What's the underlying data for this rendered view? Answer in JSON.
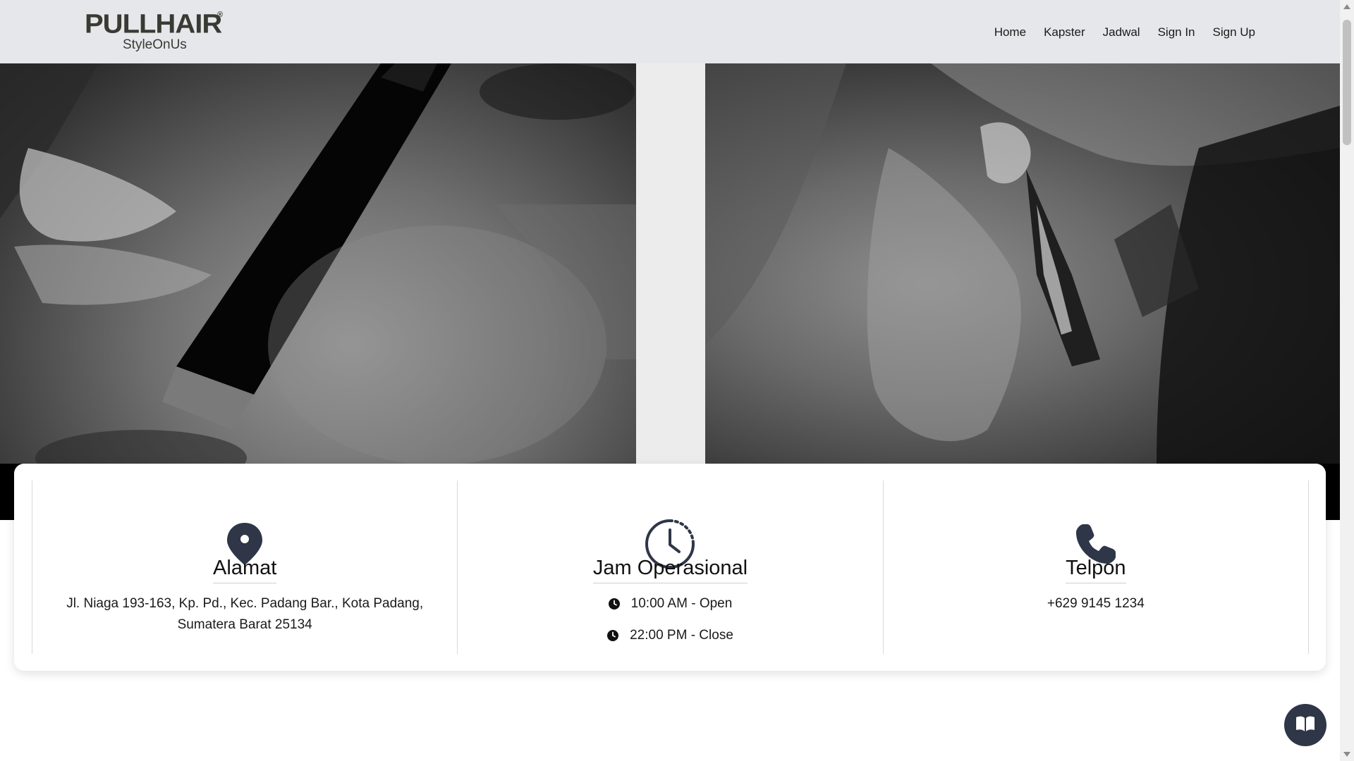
{
  "brand": {
    "name": "PULLHAIR",
    "registered": "®",
    "tagline": "StyleOnUs"
  },
  "nav": {
    "items": [
      {
        "label": "Home"
      },
      {
        "label": "Kapster"
      },
      {
        "label": "Jadwal"
      },
      {
        "label": "Sign In"
      },
      {
        "label": "Sign Up"
      }
    ]
  },
  "info": {
    "address": {
      "icon": "map-pin-icon",
      "title": "Alamat",
      "text": "Jl. Niaga 193-163, Kp. Pd., Kec. Padang Bar., Kota Padang, Sumatera Barat 25134"
    },
    "hours": {
      "icon": "clock-icon",
      "title": "Jam Operasional",
      "open": "10:00 AM - Open",
      "close": "22:00 PM - Close"
    },
    "phone": {
      "icon": "phone-icon",
      "title": "Telpon",
      "number": "+629 9145 1234"
    }
  },
  "floating_button": {
    "icon": "book-icon"
  },
  "colors": {
    "navbar_bg": "#e6e7ea",
    "icon_color": "#2e3648",
    "button_bg": "#2e3648"
  }
}
